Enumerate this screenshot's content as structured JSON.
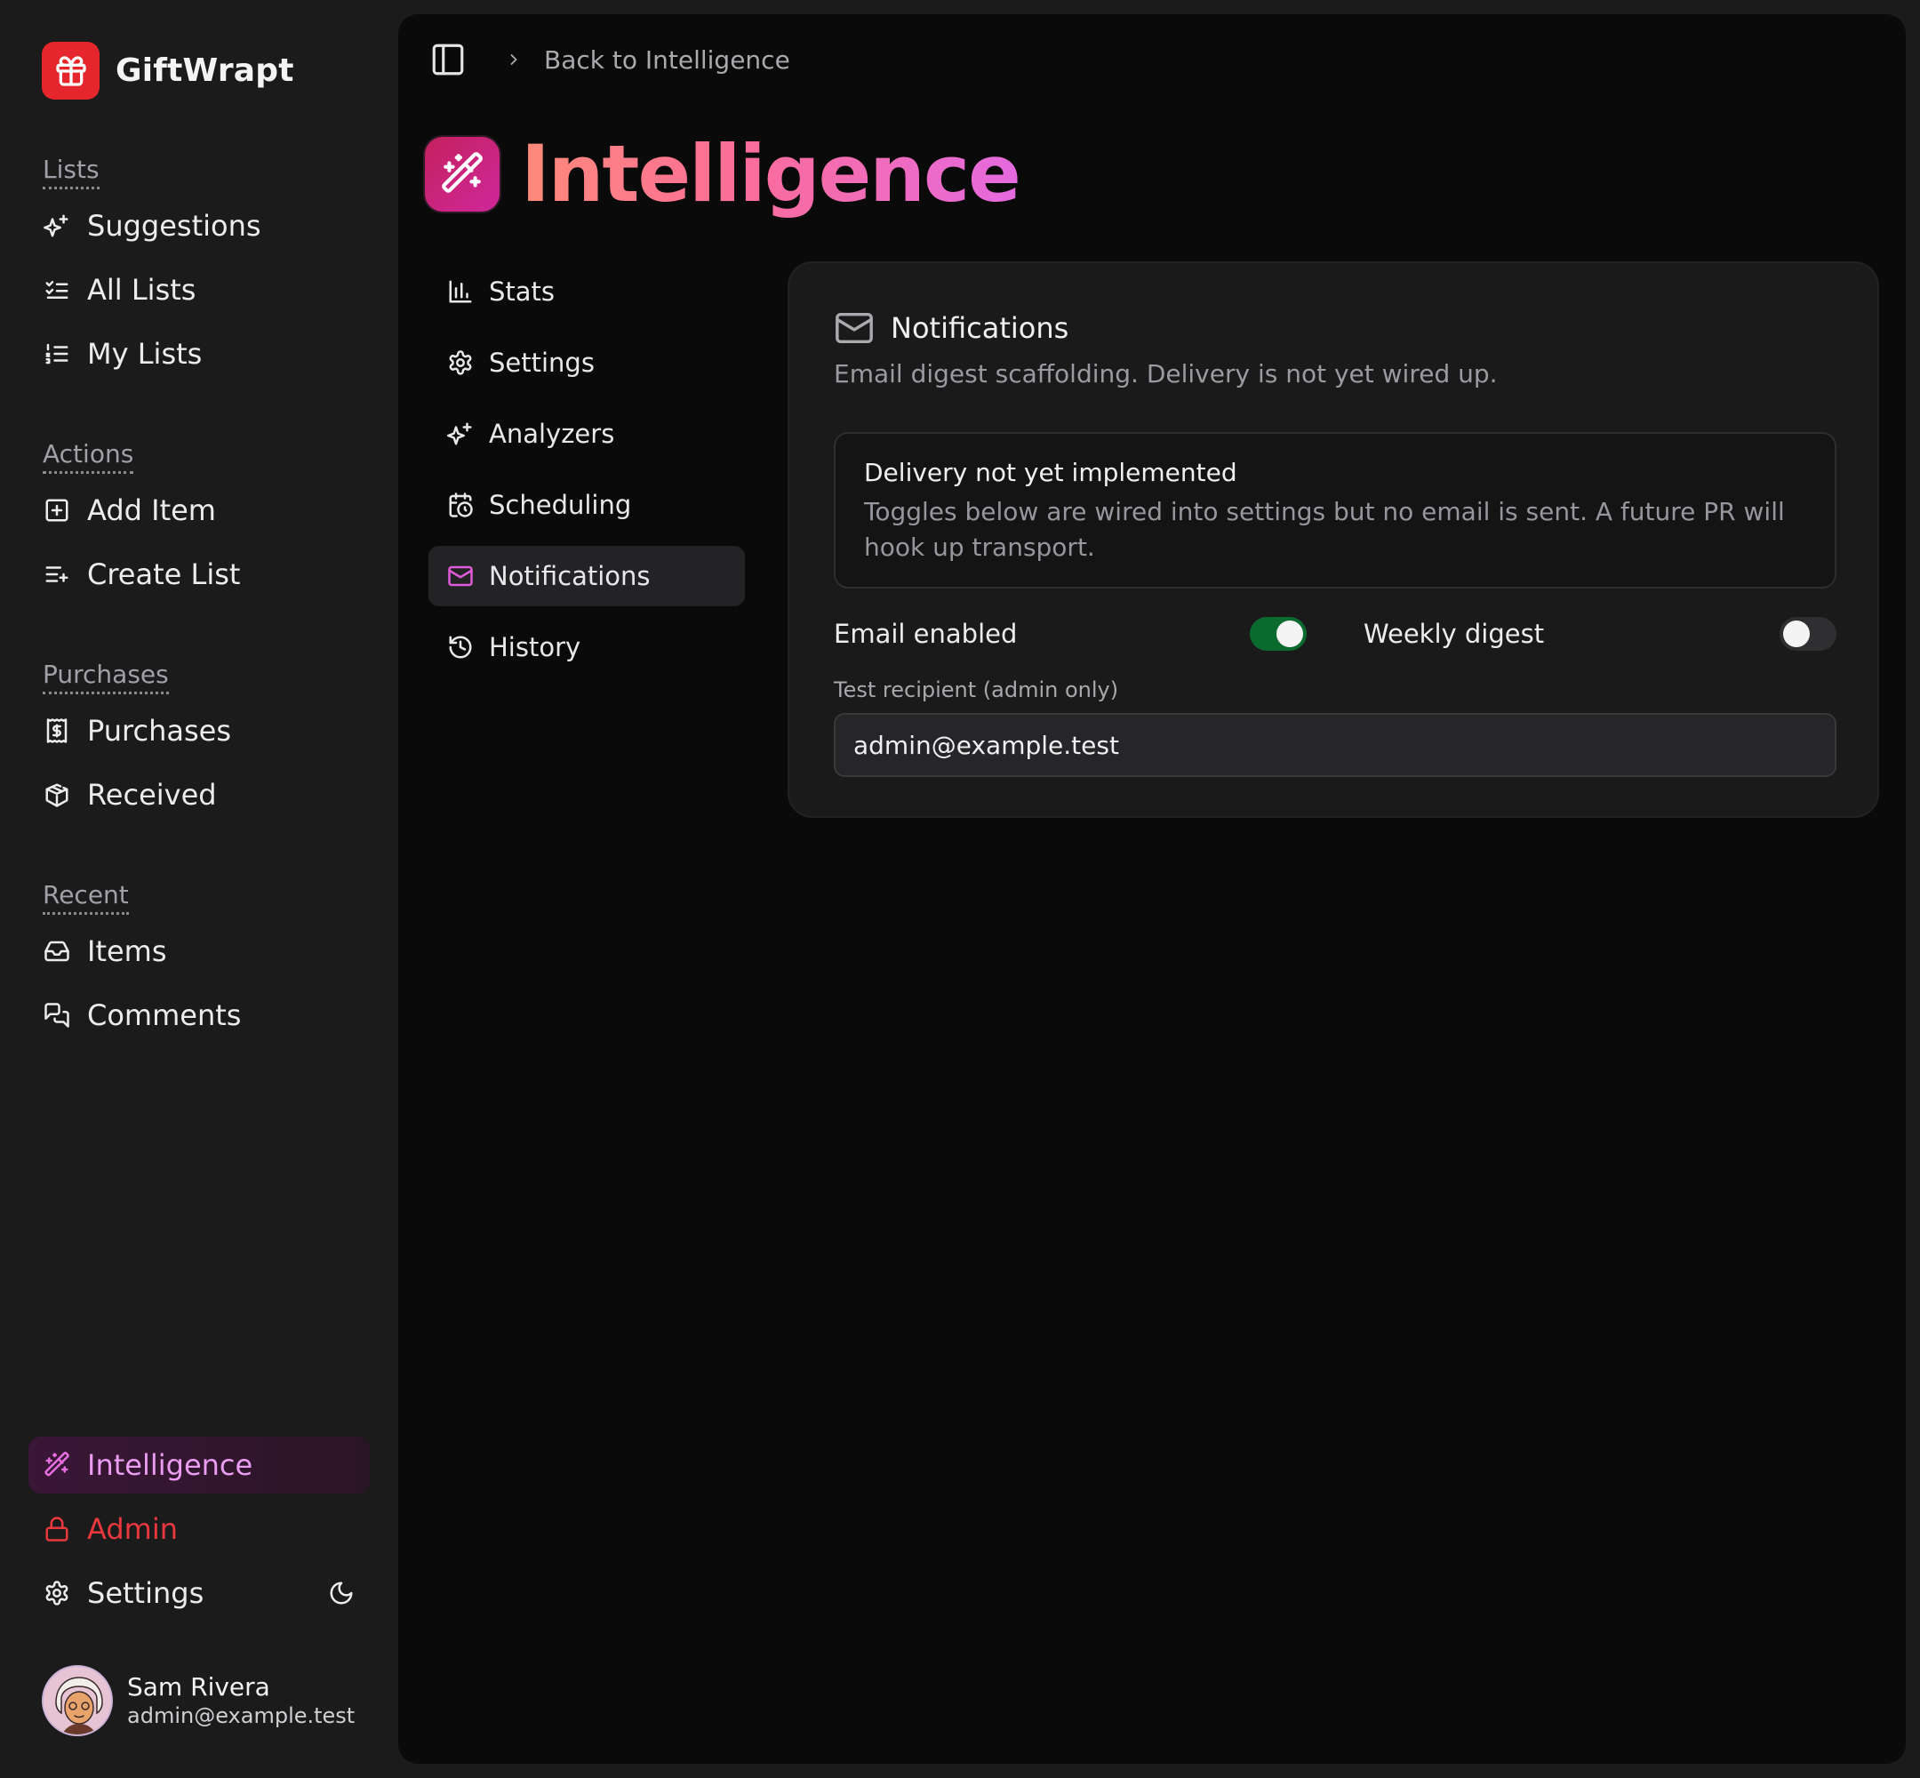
{
  "app": {
    "name": "GiftWrapt",
    "accent": "#e5262c"
  },
  "sidebar": {
    "sections": [
      {
        "label": "Lists",
        "items": [
          {
            "label": "Suggestions",
            "icon": "sparkles-icon"
          },
          {
            "label": "All Lists",
            "icon": "list-checks-icon"
          },
          {
            "label": "My Lists",
            "icon": "list-ordered-icon"
          }
        ]
      },
      {
        "label": "Actions",
        "items": [
          {
            "label": "Add Item",
            "icon": "square-plus-icon"
          },
          {
            "label": "Create List",
            "icon": "list-plus-icon"
          }
        ]
      },
      {
        "label": "Purchases",
        "items": [
          {
            "label": "Purchases",
            "icon": "receipt-icon"
          },
          {
            "label": "Received",
            "icon": "package-open-icon"
          }
        ]
      },
      {
        "label": "Recent",
        "items": [
          {
            "label": "Items",
            "icon": "inbox-icon"
          },
          {
            "label": "Comments",
            "icon": "messages-icon"
          }
        ]
      }
    ],
    "bottom": {
      "intelligence": "Intelligence",
      "admin": "Admin",
      "settings": "Settings"
    },
    "user": {
      "name": "Sam Rivera",
      "email": "admin@example.test"
    }
  },
  "breadcrumb": {
    "back_label": "Back to Intelligence"
  },
  "page": {
    "title": "Intelligence"
  },
  "subnav": {
    "items": [
      {
        "label": "Stats",
        "icon": "bar-chart-icon"
      },
      {
        "label": "Settings",
        "icon": "gear-icon"
      },
      {
        "label": "Analyzers",
        "icon": "sparkles-icon"
      },
      {
        "label": "Scheduling",
        "icon": "calendar-clock-icon"
      },
      {
        "label": "Notifications",
        "icon": "mail-icon",
        "active": true
      },
      {
        "label": "History",
        "icon": "history-icon"
      }
    ]
  },
  "card": {
    "title": "Notifications",
    "description": "Email digest scaffolding. Delivery is not yet wired up.",
    "alert": {
      "title": "Delivery not yet implemented",
      "body": "Toggles below are wired into settings but no email is sent. A future PR will hook up transport."
    },
    "toggles": [
      {
        "label": "Email enabled",
        "on": true
      },
      {
        "label": "Weekly digest",
        "on": false
      }
    ],
    "recipient": {
      "label": "Test recipient (admin only)",
      "value": "admin@example.test"
    }
  },
  "colors": {
    "toggle_on": "#0b6b2e",
    "title_gradient": [
      "#ff8a7a",
      "#fb6d9a",
      "#e46adf"
    ],
    "admin": "#e8383d",
    "intelligence": "#e99cf0"
  }
}
